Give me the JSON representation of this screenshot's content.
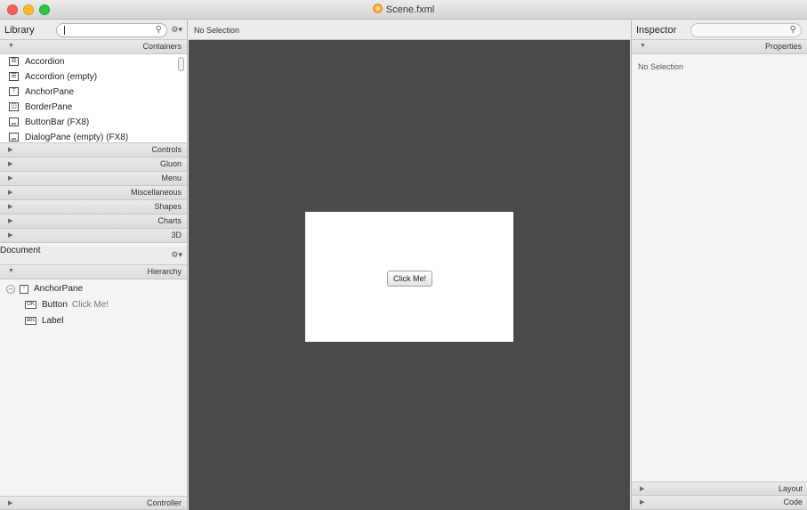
{
  "window": {
    "title": "Scene.fxml"
  },
  "library": {
    "title": "Library",
    "search_value": "",
    "sections_top": "Containers",
    "containers": [
      {
        "label": "Accordion",
        "icon": "accordion-icon"
      },
      {
        "label": "Accordion  (empty)",
        "icon": "accordion-icon"
      },
      {
        "label": "AnchorPane",
        "icon": "anchor-pane-icon"
      },
      {
        "label": "BorderPane",
        "icon": "border-pane-icon"
      },
      {
        "label": "ButtonBar  (FX8)",
        "icon": "button-bar-icon"
      },
      {
        "label": "DialogPane (empty)  (FX8)",
        "icon": "dialog-pane-icon"
      }
    ],
    "sections": [
      "Controls",
      "Gluon",
      "Menu",
      "Miscellaneous",
      "Shapes",
      "Charts",
      "3D"
    ]
  },
  "document": {
    "title": "Document",
    "section": "Hierarchy",
    "tree": [
      {
        "label": "AnchorPane",
        "sub": ""
      },
      {
        "label": "Button",
        "sub": "Click Me!"
      },
      {
        "label": "Label",
        "sub": ""
      }
    ],
    "bottom_section": "Controller"
  },
  "canvas": {
    "selection_text": "No Selection",
    "button_label": "Click Me!"
  },
  "inspector": {
    "title": "Inspector",
    "section": "Properties",
    "empty_text": "No Selection",
    "bottom_sections": [
      "Layout",
      "Code"
    ]
  }
}
